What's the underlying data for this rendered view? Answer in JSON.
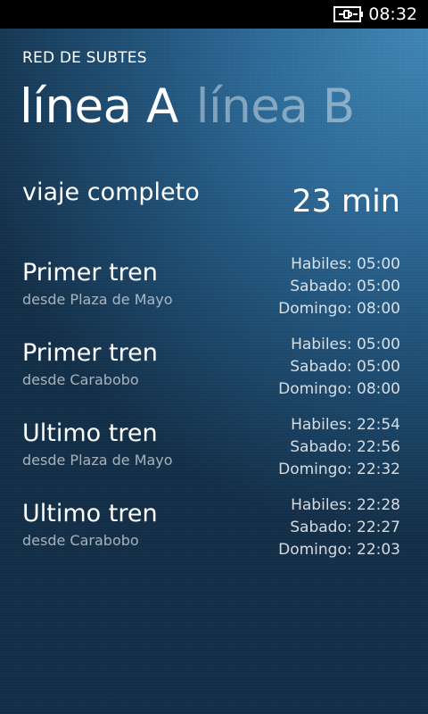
{
  "status_bar": {
    "time": "08:32",
    "battery_icon": "battery-charging-icon"
  },
  "app": {
    "title": "RED DE SUBTES"
  },
  "pivot": {
    "items": [
      {
        "label": "línea A",
        "active": true
      },
      {
        "label": "línea B",
        "active": false
      }
    ]
  },
  "trip": {
    "label": "viaje completo",
    "value": "23 min"
  },
  "trains": [
    {
      "title": "Primer tren",
      "from": "desde Plaza de Mayo",
      "times": [
        "Habiles: 05:00",
        "Sabado: 05:00",
        "Domingo: 08:00"
      ]
    },
    {
      "title": "Primer tren",
      "from": "desde Carabobo",
      "times": [
        "Habiles: 05:00",
        "Sabado: 05:00",
        "Domingo: 08:00"
      ]
    },
    {
      "title": "Ultimo tren",
      "from": "desde Plaza de Mayo",
      "times": [
        "Habiles: 22:54",
        "Sabado: 22:56",
        "Domingo: 22:32"
      ]
    },
    {
      "title": "Ultimo tren",
      "from": "desde Carabobo",
      "times": [
        "Habiles: 22:28",
        "Sabado: 22:27",
        "Domingo: 22:03"
      ]
    }
  ]
}
